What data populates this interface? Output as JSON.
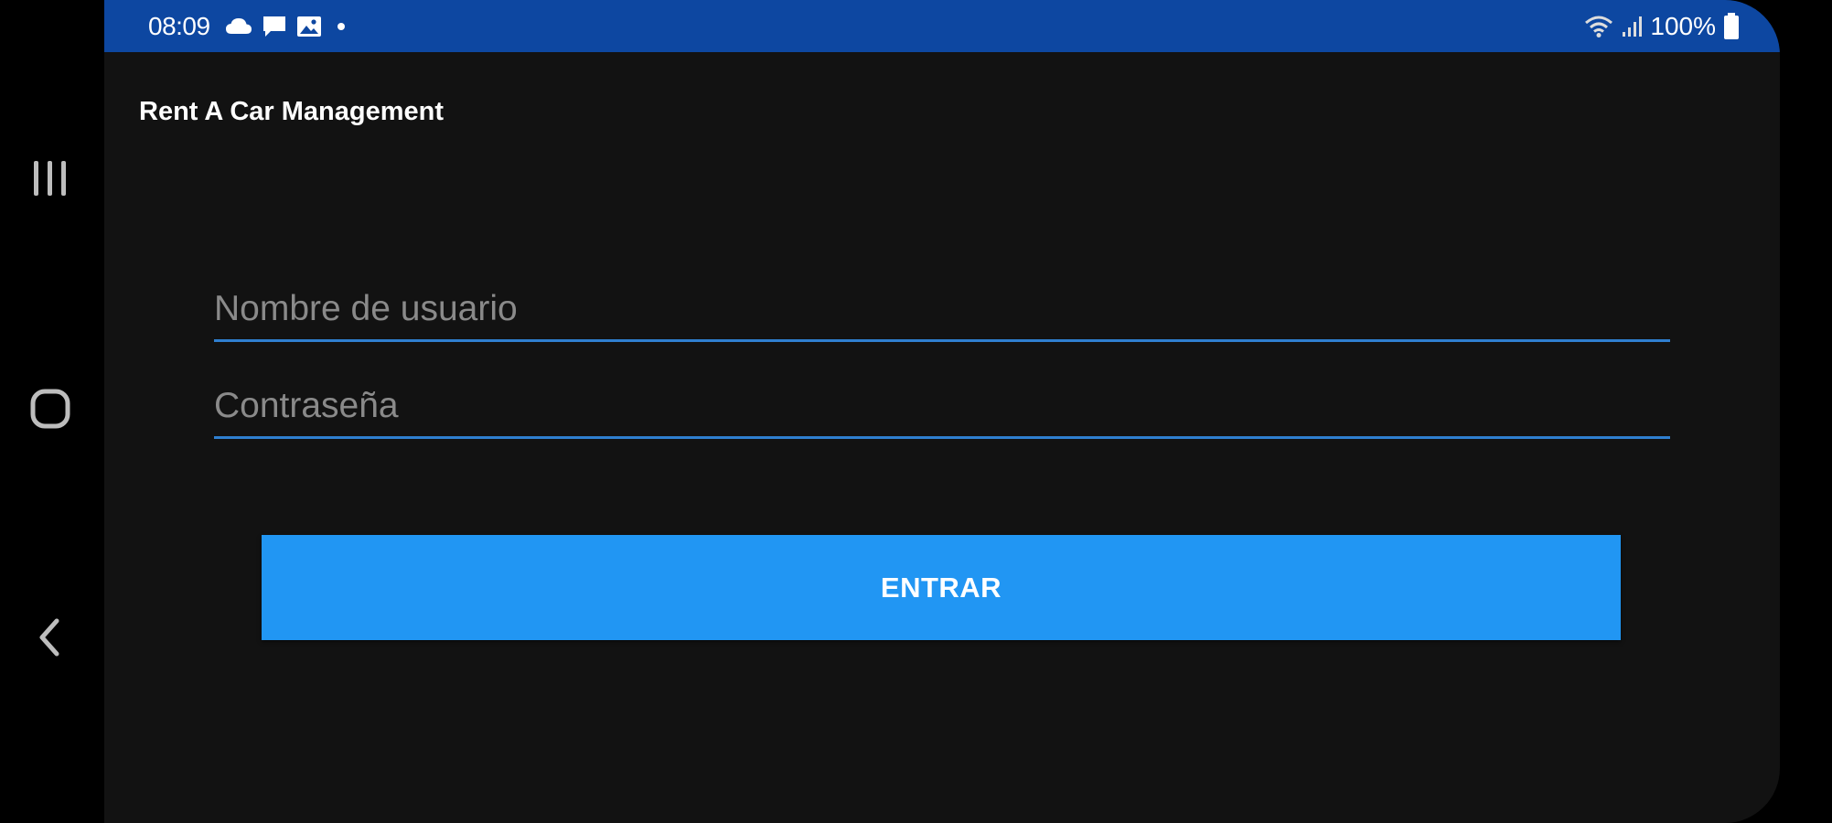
{
  "status_bar": {
    "time": "08:09",
    "left_icons": [
      "cloud-icon",
      "message-icon",
      "image-icon",
      "dot-icon"
    ],
    "battery_text": "100%",
    "right_icons": [
      "wifi-icon",
      "signal-icon",
      "battery-icon"
    ]
  },
  "nav_bar": {
    "buttons": [
      "recent-apps-icon",
      "home-icon",
      "back-icon"
    ]
  },
  "app": {
    "title": "Rent A Car Management"
  },
  "login_form": {
    "username_placeholder": "Nombre de usuario",
    "username_value": "",
    "password_placeholder": "Contraseña",
    "password_value": "",
    "submit_label": "ENTRAR"
  },
  "colors": {
    "status_bar": "#0d47a1",
    "background": "#121212",
    "accent": "#2196f3",
    "field_underline": "#2f7fd0"
  }
}
